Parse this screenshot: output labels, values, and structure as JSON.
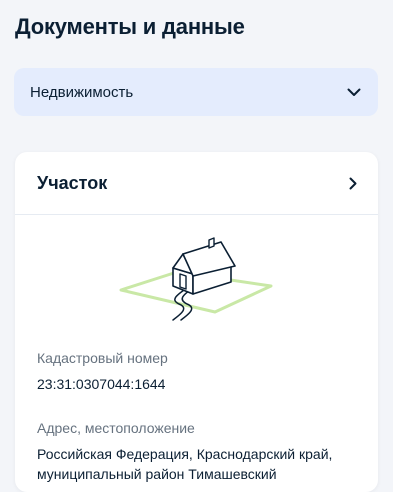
{
  "header": {
    "title": "Документы и данные"
  },
  "category_select": {
    "value": "Недвижимость",
    "icon": "chevron-down-icon"
  },
  "property_card": {
    "title": "Участок",
    "open_icon": "chevron-right-icon",
    "illustration": "house-on-land-plot-icon",
    "fields": {
      "cadastral": {
        "label": "Кадастровый номер",
        "value": "23:31:0307044:1644"
      },
      "address": {
        "label": "Адрес, местоположение",
        "value": "Российская Федерация, Краснодарский край, муниципальный район Тимашевский"
      }
    }
  },
  "colors": {
    "text_primary": "#0b1f33",
    "text_secondary": "#66727f",
    "select_background": "#e4ecfd",
    "page_background": "#f3f5f9",
    "card_background": "#ffffff",
    "plot_outline": "#c9e8a6"
  }
}
